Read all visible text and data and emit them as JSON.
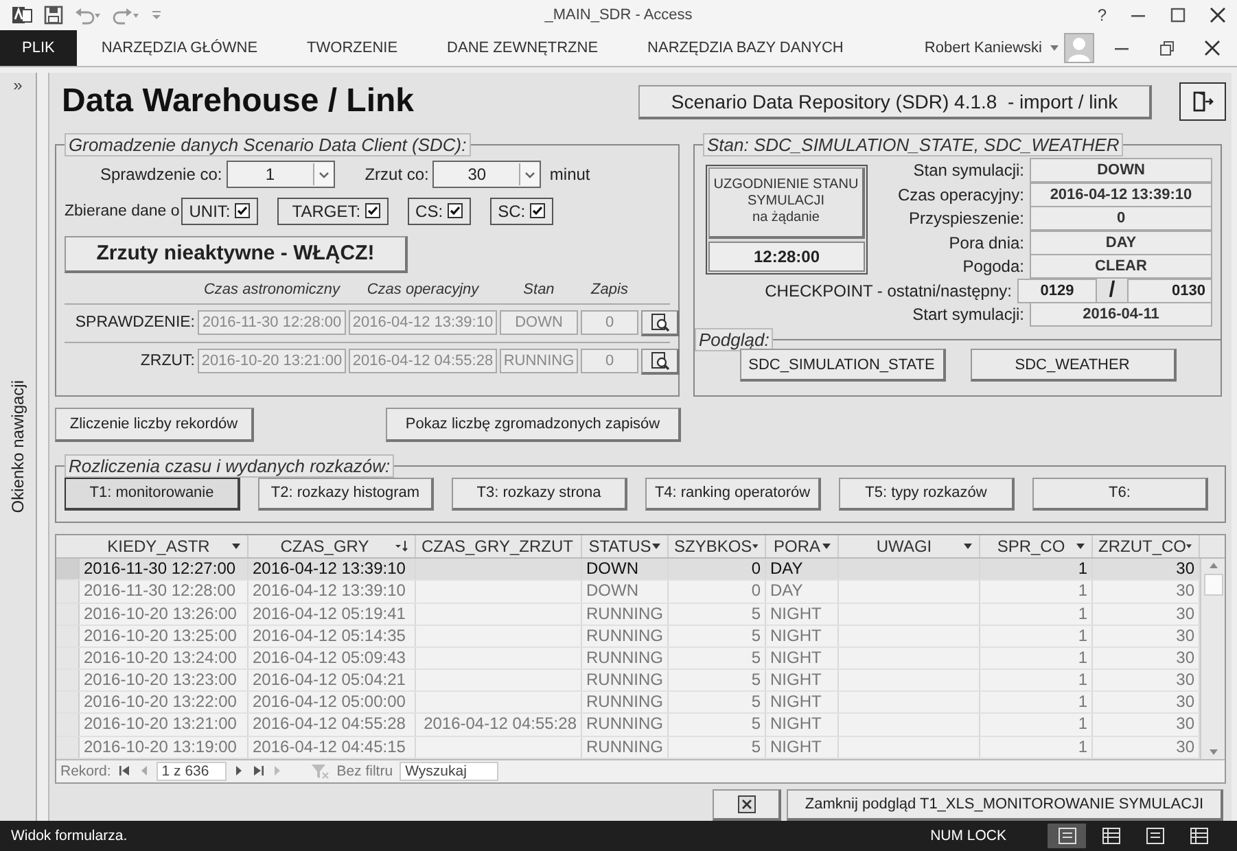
{
  "window": {
    "title": "_MAIN_SDR - Access",
    "help": "?"
  },
  "ribbon": {
    "tabs": [
      {
        "label": "PLIK",
        "kind": "file"
      },
      {
        "label": "NARZĘDZIA GŁÓWNE",
        "kind": "tab"
      },
      {
        "label": "TWORZENIE",
        "kind": "tab"
      },
      {
        "label": "DANE ZEWNĘTRZNE",
        "kind": "tab"
      },
      {
        "label": "NARZĘDZIA BAZY DANYCH",
        "kind": "tab"
      }
    ],
    "user": "Robert Kaniewski"
  },
  "nav_pane": {
    "toggle": "»",
    "label": "Okienko nawigacji"
  },
  "form": {
    "title": "Data Warehouse / Link",
    "version_button": "Scenario Data Repository (SDR) 4.1.8  - import / link"
  },
  "sdc": {
    "legend": "Gromadzenie danych Scenario Data Client (SDC):",
    "check": {
      "label": "Sprawdzenie co:",
      "value": "1"
    },
    "dump": {
      "label": "Zrzut co:",
      "value": "30",
      "unit": "minut"
    },
    "collect_label": "Zbierane dane o",
    "collect": [
      {
        "label": "UNIT:",
        "checked": true
      },
      {
        "label": "TARGET:",
        "checked": true
      },
      {
        "label": "CS:",
        "checked": true
      },
      {
        "label": "SC:",
        "checked": true
      }
    ],
    "toggle_button": "Zrzuty nieaktywne - WŁĄCZ!",
    "columns": [
      "Czas astronomiczny",
      "Czas operacyjny",
      "Stan",
      "Zapis"
    ],
    "rows": [
      {
        "label": "SPRAWDZENIE:",
        "astro": "2016-11-30 12:28:00",
        "oper": "2016-04-12 13:39:10",
        "state": "DOWN",
        "count": "0"
      },
      {
        "label": "ZRZUT:",
        "astro": "2016-10-20 13:21:00",
        "oper": "2016-04-12 04:55:28",
        "state": "RUNNING",
        "count": "0"
      }
    ]
  },
  "count_buttons": [
    "Zliczenie liczby rekordów",
    "Pokaz liczbę zgromadzonych zapisów"
  ],
  "state": {
    "legend": "Stan: SDC_SIMULATION_STATE, SDC_WEATHER",
    "sync_button": "UZGODNIENIE STANU\nSYMULACJI\nna żądanie",
    "sync_time": "12:28:00",
    "fields": [
      {
        "label": "Stan symulacji:",
        "value": "DOWN"
      },
      {
        "label": "Czas operacyjny:",
        "value": "2016-04-12 13:39:10"
      },
      {
        "label": "Przyspieszenie:",
        "value": "0"
      },
      {
        "label": "Pora dnia:",
        "value": "DAY"
      },
      {
        "label": "Pogoda:",
        "value": "CLEAR"
      }
    ],
    "checkpoint": {
      "label": "CHECKPOINT - ostatni/następny:",
      "last": "0129",
      "separator": "/",
      "next": "0130"
    },
    "start": {
      "label": "Start symulacji:",
      "value": "2016-04-11"
    },
    "preview": {
      "legend": "Podgląd:",
      "buttons": [
        "SDC_SIMULATION_STATE",
        "SDC_WEATHER"
      ]
    }
  },
  "reports": {
    "legend": "Rozliczenia czasu i wydanych rozkazów:",
    "buttons": [
      {
        "label": "T1: monitorowanie",
        "selected": true
      },
      {
        "label": "T2: rozkazy histogram",
        "selected": false
      },
      {
        "label": "T3: rozkazy strona",
        "selected": false
      },
      {
        "label": "T4: ranking operatorów",
        "selected": false
      },
      {
        "label": "T5: typy rozkazów",
        "selected": false
      },
      {
        "label": "T6:",
        "selected": false
      }
    ]
  },
  "table": {
    "columns": [
      {
        "label": "KIEDY_ASTR",
        "kind": "text",
        "sorted": false
      },
      {
        "label": "CZAS_GRY",
        "kind": "text",
        "sorted": true
      },
      {
        "label": "CZAS_GRY_ZRZUT",
        "kind": "number",
        "sorted": false
      },
      {
        "label": "STATUS",
        "kind": "text",
        "sorted": false
      },
      {
        "label": "SZYBKOS",
        "kind": "number",
        "sorted": false
      },
      {
        "label": "PORA",
        "kind": "text",
        "sorted": false
      },
      {
        "label": "UWAGI",
        "kind": "text",
        "sorted": false
      },
      {
        "label": "SPR_CO",
        "kind": "number",
        "sorted": false
      },
      {
        "label": "ZRZUT_CO",
        "kind": "number",
        "sorted": false
      }
    ],
    "rows": [
      {
        "selected": true,
        "cells": [
          "2016-11-30 12:27:00",
          "2016-04-12 13:39:10",
          "",
          "DOWN",
          "0",
          "DAY",
          "",
          "1",
          "30"
        ]
      },
      {
        "selected": false,
        "cells": [
          "2016-11-30 12:28:00",
          "2016-04-12 13:39:10",
          "",
          "DOWN",
          "0",
          "DAY",
          "",
          "1",
          "30"
        ]
      },
      {
        "selected": false,
        "cells": [
          "2016-10-20 13:26:00",
          "2016-04-12 05:19:41",
          "",
          "RUNNING",
          "5",
          "NIGHT",
          "",
          "1",
          "30"
        ]
      },
      {
        "selected": false,
        "cells": [
          "2016-10-20 13:25:00",
          "2016-04-12 05:14:35",
          "",
          "RUNNING",
          "5",
          "NIGHT",
          "",
          "1",
          "30"
        ]
      },
      {
        "selected": false,
        "cells": [
          "2016-10-20 13:24:00",
          "2016-04-12 05:09:43",
          "",
          "RUNNING",
          "5",
          "NIGHT",
          "",
          "1",
          "30"
        ]
      },
      {
        "selected": false,
        "cells": [
          "2016-10-20 13:23:00",
          "2016-04-12 05:04:21",
          "",
          "RUNNING",
          "5",
          "NIGHT",
          "",
          "1",
          "30"
        ]
      },
      {
        "selected": false,
        "cells": [
          "2016-10-20 13:22:00",
          "2016-04-12 05:00:00",
          "",
          "RUNNING",
          "5",
          "NIGHT",
          "",
          "1",
          "30"
        ]
      },
      {
        "selected": false,
        "cells": [
          "2016-10-20 13:21:00",
          "2016-04-12 04:55:28",
          "2016-04-12 04:55:28",
          "RUNNING",
          "5",
          "NIGHT",
          "",
          "1",
          "30"
        ]
      },
      {
        "selected": false,
        "cells": [
          "2016-10-20 13:19:00",
          "2016-04-12 04:45:15",
          "",
          "RUNNING",
          "5",
          "NIGHT",
          "",
          "1",
          "30"
        ]
      }
    ],
    "nav": {
      "label": "Rekord:",
      "position": "1 z 636",
      "filter": "Bez filtru",
      "search": "Wyszukaj"
    }
  },
  "footer": {
    "close_button": "Zamknij podgląd T1_XLS_MONITOROWANIE SYMULACJI"
  },
  "status_bar": {
    "text": "Widok formularza.",
    "num_lock": "NUM LOCK",
    "views": [
      {
        "selected": true
      },
      {
        "selected": false
      },
      {
        "selected": false
      },
      {
        "selected": false
      }
    ]
  }
}
